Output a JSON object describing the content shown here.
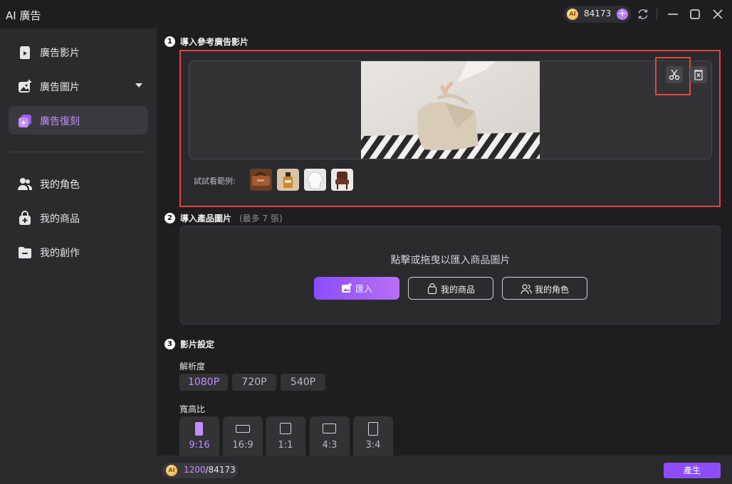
{
  "app": {
    "title": "AI 廣告"
  },
  "header": {
    "credits": "84173"
  },
  "sidebar": {
    "items": [
      {
        "label": "廣告影片",
        "icon": "video-play-icon"
      },
      {
        "label": "廣告圖片",
        "icon": "image-add-icon"
      },
      {
        "label": "廣告復刻",
        "icon": "replicate-icon",
        "active": true
      },
      {
        "label": "我的角色",
        "icon": "people-icon"
      },
      {
        "label": "我的商品",
        "icon": "shopping-bag-icon"
      },
      {
        "label": "我的創作",
        "icon": "folder-icon"
      }
    ]
  },
  "step1": {
    "number": "1",
    "title": "導入參考廣告影片",
    "examples_label": "試試看範例:"
  },
  "step2": {
    "number": "2",
    "title": "導入產品圖片",
    "hint": "(最多 7 張)",
    "upload_hint": "點擊或拖曳以匯入商品圖片",
    "import_label": "匯入",
    "my_products_label": "我的商品",
    "my_roles_label": "我的角色"
  },
  "step3": {
    "number": "3",
    "title": "影片設定",
    "resolution_label": "解析度",
    "resolutions": [
      "1080P",
      "720P",
      "540P"
    ],
    "resolution_selected": "1080P",
    "aspect_label": "寬高比",
    "ratios": [
      "9:16",
      "16:9",
      "1:1",
      "4:3",
      "3:4"
    ],
    "ratio_selected": "9:16"
  },
  "footer": {
    "cost_used": "1200",
    "cost_total": "/84173",
    "generate_label": "產生"
  },
  "colors": {
    "accent": "#c58cff",
    "primary_button": "#8d4cf7",
    "highlight_border": "#e0453e",
    "sidebar_bg": "#2b2b2e",
    "main_bg": "#1e1e20"
  }
}
